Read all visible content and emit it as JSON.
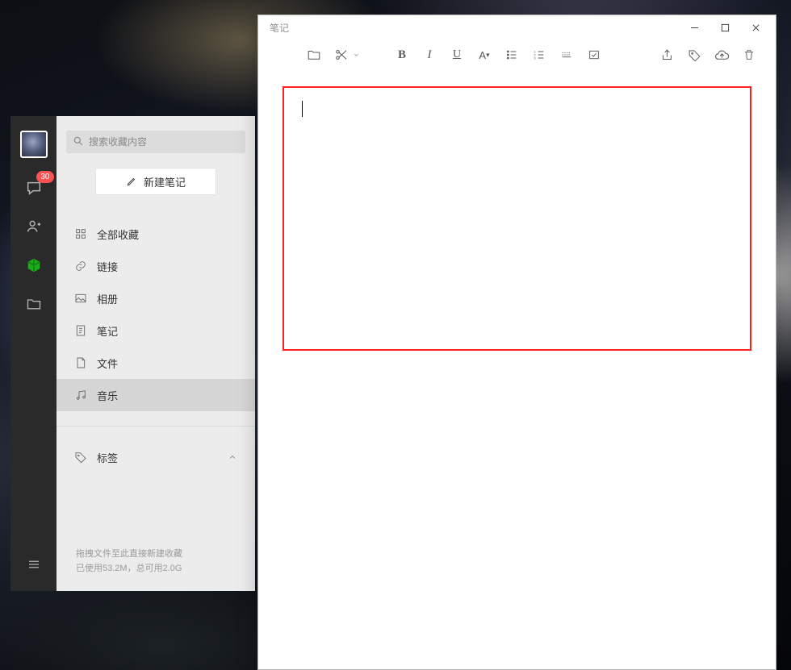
{
  "rail": {
    "chat_badge": "30"
  },
  "panel": {
    "search_placeholder": "搜索收藏内容",
    "new_note_label": "新建笔记",
    "categories": [
      {
        "label": "全部收藏",
        "icon": "grid"
      },
      {
        "label": "链接",
        "icon": "link"
      },
      {
        "label": "相册",
        "icon": "image"
      },
      {
        "label": "笔记",
        "icon": "note"
      },
      {
        "label": "文件",
        "icon": "file"
      },
      {
        "label": "音乐",
        "icon": "music"
      }
    ],
    "active_category_index": 5,
    "tags_label": "标签",
    "footer_line1": "拖拽文件至此直接新建收藏",
    "footer_line2": "已使用53.2M，总可用2.0G"
  },
  "notewin": {
    "title": "笔记"
  }
}
